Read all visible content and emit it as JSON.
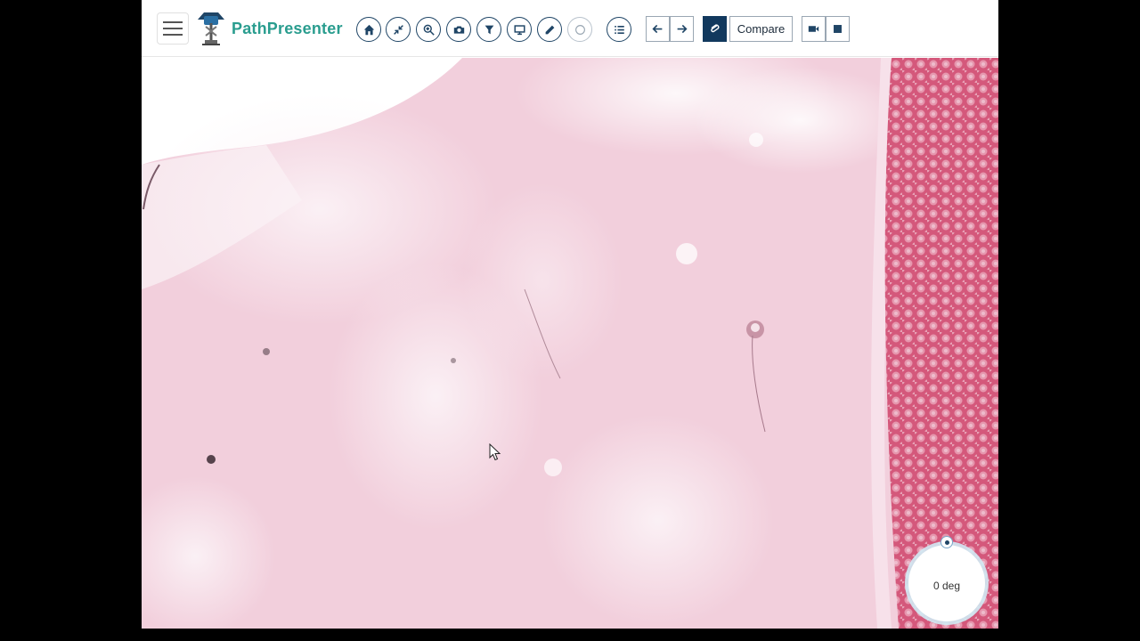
{
  "app": {
    "brand": "PathPresenter"
  },
  "toolbar": {
    "menu_icon": "hamburger-icon",
    "tools": [
      {
        "name": "home",
        "icon": "home-icon"
      },
      {
        "name": "fit",
        "icon": "shrink-arrows-icon"
      },
      {
        "name": "zoom",
        "icon": "zoom-in-icon"
      },
      {
        "name": "screenshot",
        "icon": "camera-icon"
      },
      {
        "name": "filter",
        "icon": "filter-icon"
      },
      {
        "name": "presentation",
        "icon": "monitor-icon"
      },
      {
        "name": "annotate",
        "icon": "pencil-icon"
      },
      {
        "name": "rotate",
        "icon": "circle-icon"
      },
      {
        "name": "list",
        "icon": "list-icon"
      }
    ],
    "nav": {
      "back_icon": "arrow-left-icon",
      "forward_icon": "arrow-right-icon"
    },
    "pin_icon": "paperclip-icon",
    "compare_label": "Compare",
    "record_icon": "video-camera-icon",
    "stop_icon": "stop-icon"
  },
  "viewer": {
    "rotation_label": "0 deg"
  },
  "colors": {
    "brand": "#2a9d8f",
    "toolbar_icon": "#1f4566",
    "active_button": "#12395e",
    "tissue_light": "#f3d3df",
    "tissue_dense": "#d9607f"
  }
}
